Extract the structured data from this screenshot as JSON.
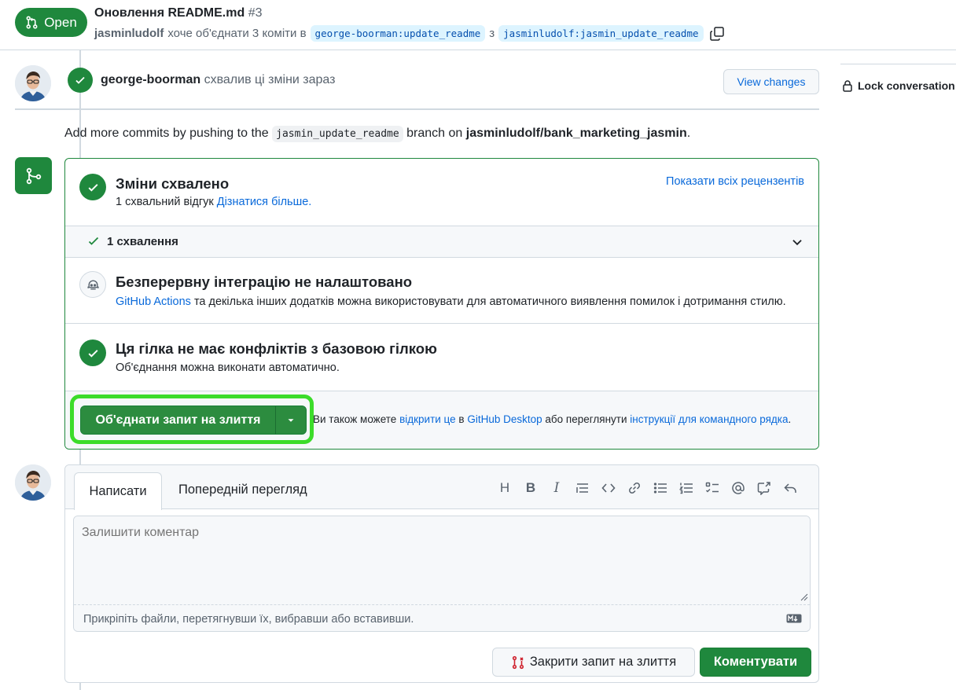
{
  "header": {
    "state_label": "Open",
    "title": "Оновлення README.md",
    "number": "#3",
    "author": "jasminludolf",
    "merge_text": "хоче об'єднати 3 коміти в",
    "base_branch": "george-boorman:update_readme",
    "connector": "з",
    "head_branch": "jasminludolf:jasmin_update_readme"
  },
  "review": {
    "reviewer": "george-boorman",
    "action_text": "схвалив ці зміни зараз",
    "view_changes_label": "View changes"
  },
  "sidebar": {
    "lock_label": "Lock conversation"
  },
  "push_hint": {
    "prefix": "Add more commits by pushing to the",
    "branch": "jasmin_update_readme",
    "middle": "branch on",
    "repo": "jasminludolf/bank_marketing_jasmin",
    "suffix": "."
  },
  "merge_box": {
    "approved_title": "Зміни схвалено",
    "approved_desc": "1 схвальний відгук",
    "learn_more": "Дізнатися більше.",
    "show_reviewers": "Показати всіх рецензентів",
    "approvals_label": "1 схвалення",
    "ci_title": "Безперервну інтеграцію не налаштовано",
    "ci_link": "GitHub Actions",
    "ci_desc": "та декілька інших додатків можна використовувати для автоматичного виявлення помилок і дотримання стилю.",
    "conflicts_title": "Ця гілка не має конфліктів з базовою гілкою",
    "conflicts_desc": "Об'єднання можна виконати автоматично.",
    "merge_button": "Об'єднати запит на злиття",
    "note_prefix": "Ви також можете",
    "note_link1": "відкрити це",
    "note_middle1": "в",
    "note_link2": "GitHub Desktop",
    "note_middle2": "або переглянути",
    "note_link3": "інструкції для командного рядка",
    "note_suffix": "."
  },
  "comment": {
    "tab_write": "Написати",
    "tab_preview": "Попередній перегляд",
    "placeholder": "Залишити коментар",
    "attach_text": "Прикріпіть файли, перетягнувши їх, вибравши або вставивши.",
    "close_button": "Закрити запит на злиття",
    "comment_button": "Коментувати",
    "toolbar_heading": "H",
    "toolbar_bold": "B",
    "toolbar_italic": "I"
  },
  "colors": {
    "accent_green": "#1f883d",
    "link_blue": "#0969da",
    "highlight_green": "#3cdc2a"
  }
}
